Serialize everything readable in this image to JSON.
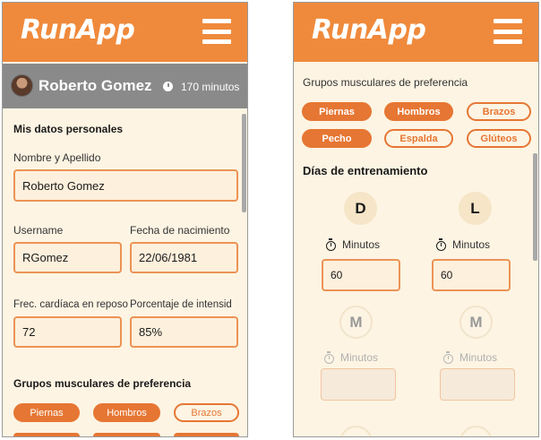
{
  "left": {
    "app": {
      "logo": "RunApp"
    },
    "user": {
      "name": "Roberto Gomez",
      "minutes": "170 minutos"
    },
    "personal": {
      "title": "Mis datos personales",
      "fullname": {
        "label": "Nombre y Apellido",
        "value": "Roberto Gomez"
      },
      "username": {
        "label": "Username",
        "value": "RGomez"
      },
      "birthdate": {
        "label": "Fecha de nacimiento",
        "value": "22/06/1981"
      },
      "heartrate": {
        "label": "Frec. cardíaca en reposo",
        "value": "72"
      },
      "intensity": {
        "label": "Porcentaje de intensid",
        "value": "85%"
      }
    },
    "muscles": {
      "title": "Grupos musculares de preferencia",
      "chips": [
        "Piernas",
        "Hombros",
        "Brazos"
      ]
    }
  },
  "right": {
    "app": {
      "logo": "RunApp"
    },
    "muscles": {
      "title": "Grupos musculares de preferencia",
      "chips": [
        "Piernas",
        "Hombros",
        "Brazos",
        "Pecho",
        "Espalda",
        "Glúteos"
      ]
    },
    "training": {
      "title": "Días de entrenamiento",
      "days": [
        {
          "letter": "D",
          "minutes_label": "Minutos",
          "value": "60"
        },
        {
          "letter": "L",
          "minutes_label": "Minutos",
          "value": "60"
        },
        {
          "letter": "M",
          "minutes_label": "Minutos",
          "value": ""
        },
        {
          "letter": "M",
          "minutes_label": "Minutos",
          "value": ""
        }
      ]
    }
  },
  "colors": {
    "accent": "#ef8a3c",
    "chip": "#e67633",
    "background": "#fdf4e3",
    "userbar": "#8a8a8a"
  },
  "icons": [
    "menu-icon",
    "avatar",
    "timer-icon",
    "stopwatch-icon"
  ]
}
